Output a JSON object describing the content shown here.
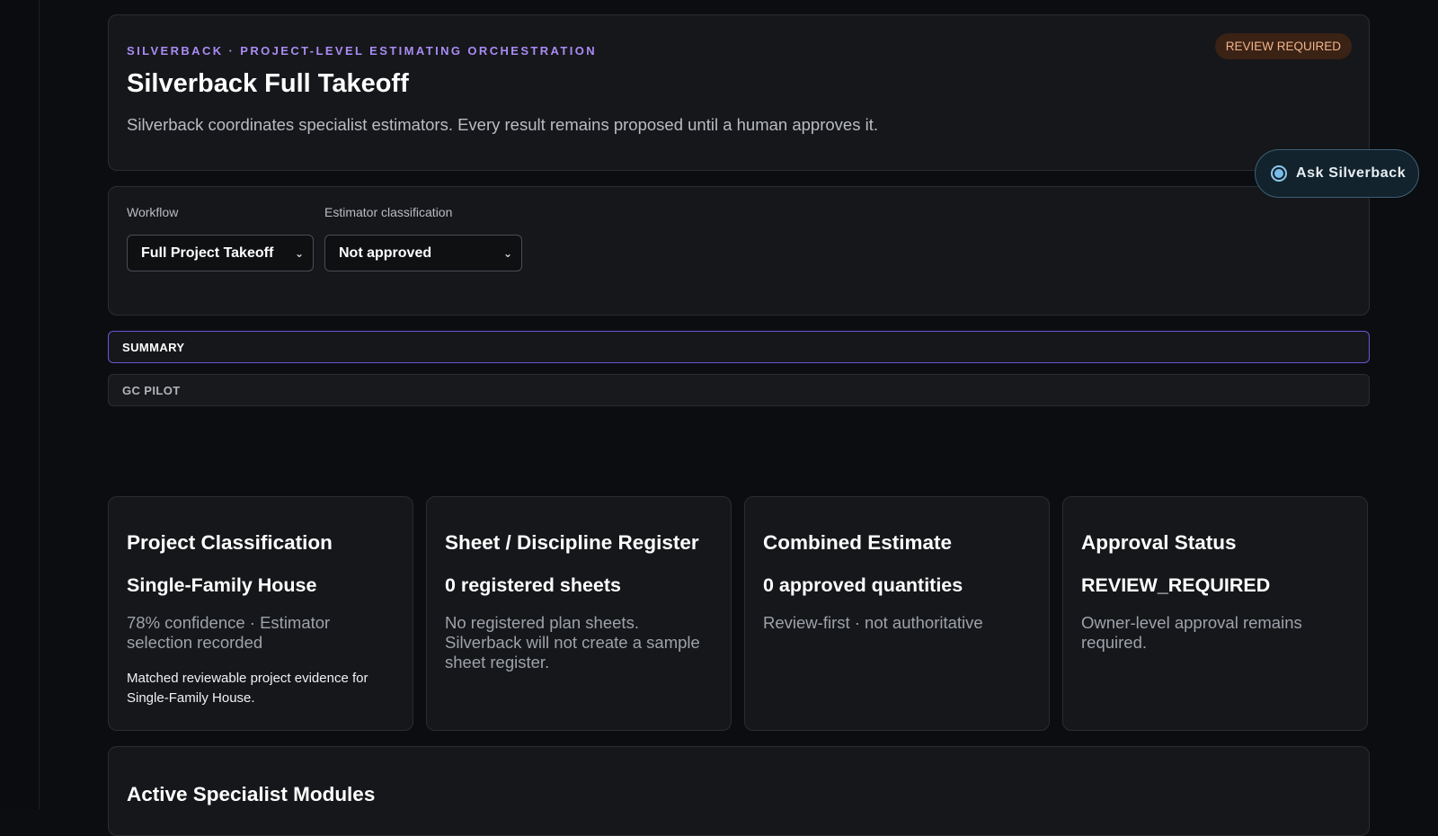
{
  "hero": {
    "eyebrow": "SILVERBACK · PROJECT-LEVEL ESTIMATING ORCHESTRATION",
    "title": "Silverback Full Takeoff",
    "description": "Silverback coordinates specialist estimators. Every result remains proposed until a human approves it.",
    "badge": "REVIEW REQUIRED"
  },
  "ask": {
    "label": "Ask Silverback"
  },
  "controls": {
    "workflow": {
      "label": "Workflow",
      "value": "Full Project Takeoff"
    },
    "classification": {
      "label": "Estimator classification",
      "value": "Not approved"
    }
  },
  "tabs": [
    {
      "label": "SUMMARY",
      "active": true
    },
    {
      "label": "GC PILOT",
      "active": false
    }
  ],
  "stats": [
    {
      "title": "Project Classification",
      "value": "Single-Family House",
      "sub": "78% confidence · Estimator selection recorded",
      "note": "Matched reviewable project evidence for Single-Family House."
    },
    {
      "title": "Sheet / Discipline Register",
      "value": "0 registered sheets",
      "sub": "No registered plan sheets. Silverback will not create a sample sheet register."
    },
    {
      "title": "Combined Estimate",
      "value": "0 approved quantities",
      "sub": "Review-first · not authoritative"
    },
    {
      "title": "Approval Status",
      "value": "REVIEW_REQUIRED",
      "sub": "Owner-level approval remains required."
    }
  ],
  "modules": {
    "title": "Active Specialist Modules"
  },
  "colors": {
    "accent": "#a98cf5",
    "tab_active_border": "#6d53d6",
    "badge_bg": "#3a2215",
    "badge_text": "#f2b48a"
  }
}
